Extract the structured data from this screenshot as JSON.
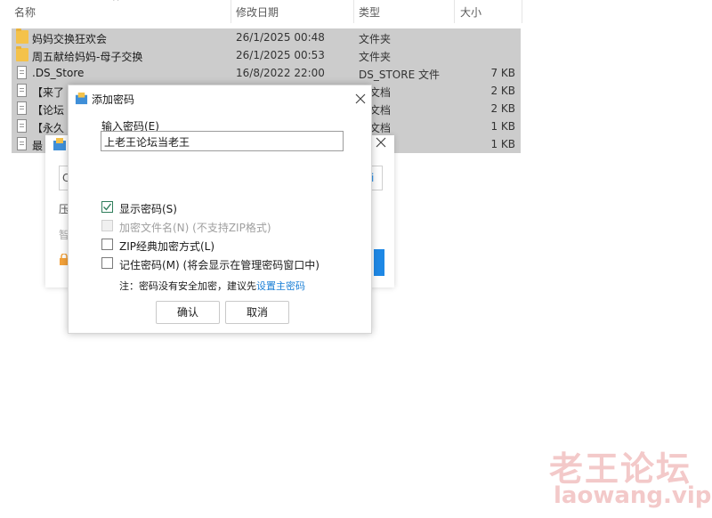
{
  "columns": {
    "name": "名称",
    "modified": "修改日期",
    "type": "类型",
    "size": "大小"
  },
  "files": [
    {
      "name": "妈妈交换狂欢会",
      "modified": "26/1/2025 00:48",
      "type": "文件夹",
      "size": "",
      "icon": "folder-icon"
    },
    {
      "name": "周五献给妈妈-母子交换",
      "modified": "26/1/2025 00:53",
      "type": "文件夹",
      "size": "",
      "icon": "folder-icon"
    },
    {
      "name": ".DS_Store",
      "modified": "16/8/2022 22:00",
      "type": "DS_STORE 文件",
      "size": "7 KB",
      "icon": "file-icon"
    },
    {
      "name": "【来了",
      "modified": "",
      "type": "本文档",
      "size": "2 KB",
      "icon": "text-file-icon"
    },
    {
      "name": "【论坛",
      "modified": "",
      "type": "本文档",
      "size": "2 KB",
      "icon": "text-file-icon"
    },
    {
      "name": "【永久",
      "modified": "",
      "type": "本文档",
      "size": "1 KB",
      "icon": "text-file-icon"
    },
    {
      "name": "最",
      "modified": "",
      "type": "档",
      "size": "1 KB",
      "icon": "text-file-icon"
    }
  ],
  "back_dialog": {
    "g1": "C",
    "g2": "压",
    "g3": "智",
    "g4": "i"
  },
  "password_dialog": {
    "title": "添加密码",
    "input_label": "输入密码(E)",
    "password_value": "上老王论坛当老王",
    "options": [
      {
        "label": "显示密码(S)",
        "checked": true,
        "disabled": false
      },
      {
        "label": "加密文件名(N) (不支持ZIP格式)",
        "checked": false,
        "disabled": true
      },
      {
        "label": "ZIP经典加密方式(L)",
        "checked": false,
        "disabled": false
      },
      {
        "label": "记住密码(M) (将会显示在管理密码窗口中)",
        "checked": false,
        "disabled": false
      }
    ],
    "note_prefix": "注：密码没有安全加密，建议先",
    "note_link": "设置主密码",
    "ok_label": "确认",
    "cancel_label": "取消"
  },
  "watermark": {
    "line1": "老王论坛",
    "line2": "laowang.vip"
  },
  "colors": {
    "selection": "#cccccc",
    "accent_link": "#1a7fd6",
    "check_green": "#2e7d5a",
    "back_button_blue": "#1e88e5"
  }
}
